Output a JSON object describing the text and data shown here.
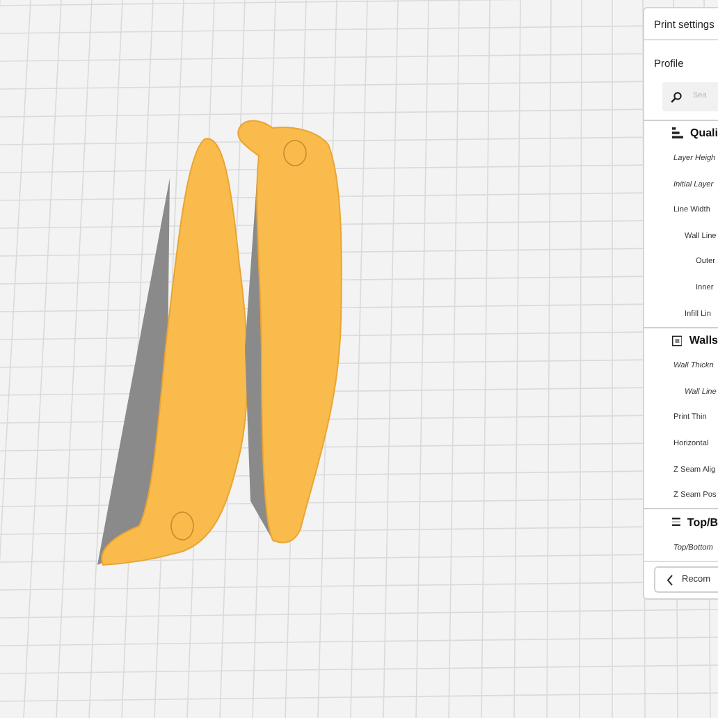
{
  "print_settings": {
    "title": "Print settings",
    "profile_label": "Profile",
    "search": {
      "placeholder": "Sea"
    },
    "categories": [
      {
        "kind": "quality",
        "label": "Quali",
        "settings": [
          {
            "label": "Layer Heigh",
            "modified": true
          },
          {
            "label": "Initial Layer",
            "modified": true
          },
          {
            "label": "Line Width",
            "modified": false,
            "children": [
              {
                "label": "Wall Line",
                "modified": false,
                "children": [
                  {
                    "label": "Outer",
                    "modified": false
                  },
                  {
                    "label": "Inner",
                    "modified": false
                  }
                ]
              },
              {
                "label": "Infill Lin",
                "modified": false
              }
            ]
          }
        ]
      },
      {
        "kind": "walls",
        "label": "Walls",
        "settings": [
          {
            "label": "Wall Thickn",
            "modified": true,
            "children": [
              {
                "label": "Wall Line",
                "modified": true
              }
            ]
          },
          {
            "label": "Print Thin",
            "modified": false
          },
          {
            "label": "Horizontal",
            "modified": false
          },
          {
            "label": "Z Seam Alig",
            "modified": false
          },
          {
            "label": "Z Seam Pos",
            "modified": false
          }
        ]
      },
      {
        "kind": "top_bottom",
        "label": "Top/B",
        "settings": [
          {
            "label": "Top/Bottom",
            "modified": true
          }
        ]
      }
    ],
    "recommended_button": "Recom"
  }
}
